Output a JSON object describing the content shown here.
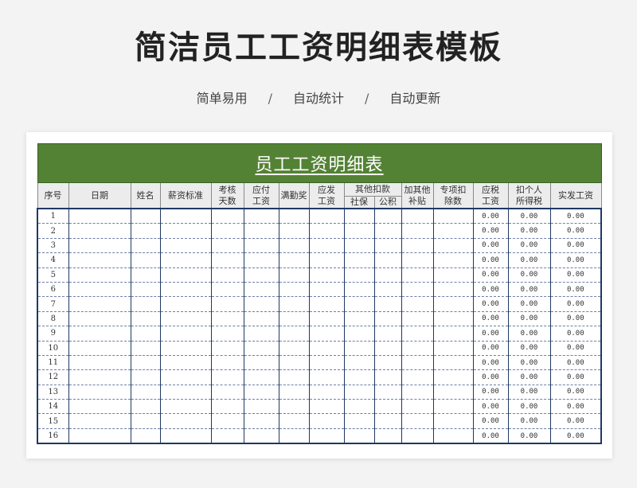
{
  "page": {
    "title": "简洁员工工资明细表模板",
    "subtitle": [
      "简单易用",
      "自动统计",
      "自动更新"
    ],
    "separator": "/"
  },
  "sheet": {
    "banner": "员工工资明细表",
    "headers": {
      "seq": "序号",
      "date": "日期",
      "name": "姓名",
      "salary_standard": "薪资标准",
      "attendance_days": "考核\n天数",
      "payable": "应付\n工资",
      "full_attendance": "满勤奖",
      "gross": "应发\n工资",
      "other_deductions": "其他扣款",
      "social_security": "社保",
      "housing_fund": "公积",
      "add_other": "加其他\n补贴",
      "special_deduction": "专项扣\n除数",
      "taxable": "应税\n工资",
      "income_tax": "扣个人\n所得税",
      "net_pay": "实发工资"
    },
    "rows": [
      {
        "seq": "1",
        "taxable": "0.00",
        "tax": "0.00",
        "net": "0.00"
      },
      {
        "seq": "2",
        "taxable": "0.00",
        "tax": "0.00",
        "net": "0.00"
      },
      {
        "seq": "3",
        "taxable": "0.00",
        "tax": "0.00",
        "net": "0.00"
      },
      {
        "seq": "4",
        "taxable": "0.00",
        "tax": "0.00",
        "net": "0.00"
      },
      {
        "seq": "5",
        "taxable": "0.00",
        "tax": "0.00",
        "net": "0.00"
      },
      {
        "seq": "6",
        "taxable": "0.00",
        "tax": "0.00",
        "net": "0.00"
      },
      {
        "seq": "7",
        "taxable": "0.00",
        "tax": "0.00",
        "net": "0.00"
      },
      {
        "seq": "8",
        "taxable": "0.00",
        "tax": "0.00",
        "net": "0.00"
      },
      {
        "seq": "9",
        "taxable": "0.00",
        "tax": "0.00",
        "net": "0.00"
      },
      {
        "seq": "10",
        "taxable": "0.00",
        "tax": "0.00",
        "net": "0.00"
      },
      {
        "seq": "11",
        "taxable": "0.00",
        "tax": "0.00",
        "net": "0.00"
      },
      {
        "seq": "12",
        "taxable": "0.00",
        "tax": "0.00",
        "net": "0.00"
      },
      {
        "seq": "13",
        "taxable": "0.00",
        "tax": "0.00",
        "net": "0.00"
      },
      {
        "seq": "14",
        "taxable": "0.00",
        "tax": "0.00",
        "net": "0.00"
      },
      {
        "seq": "15",
        "taxable": "0.00",
        "tax": "0.00",
        "net": "0.00"
      },
      {
        "seq": "16",
        "taxable": "0.00",
        "tax": "0.00",
        "net": "0.00"
      }
    ]
  },
  "colors": {
    "banner_green": "#548235",
    "grid_navy": "#1f3864",
    "header_gray": "#ececec"
  }
}
